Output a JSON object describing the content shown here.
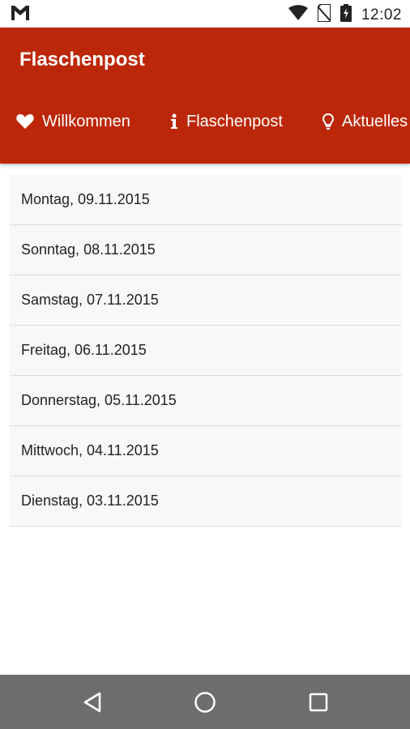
{
  "status": {
    "time": "12:02",
    "icons": [
      "gmail-icon",
      "wifi-icon",
      "no-sim-icon",
      "battery-charging-icon"
    ]
  },
  "app": {
    "title": "Flaschenpost",
    "accent_color": "#bd2709"
  },
  "tabs": [
    {
      "label": "Willkommen",
      "icon": "heart-icon"
    },
    {
      "label": "Flaschenpost",
      "icon": "info-icon"
    },
    {
      "label": "Aktuelles",
      "icon": "lightbulb-icon"
    }
  ],
  "list": {
    "items": [
      "Montag, 09.11.2015",
      "Sonntag, 08.11.2015",
      "Samstag, 07.11.2015",
      "Freitag, 06.11.2015",
      "Donnerstag, 05.11.2015",
      "Mittwoch, 04.11.2015",
      "Dienstag, 03.11.2015"
    ]
  },
  "nav": {
    "buttons": [
      "back-icon",
      "home-icon",
      "recents-icon"
    ]
  }
}
